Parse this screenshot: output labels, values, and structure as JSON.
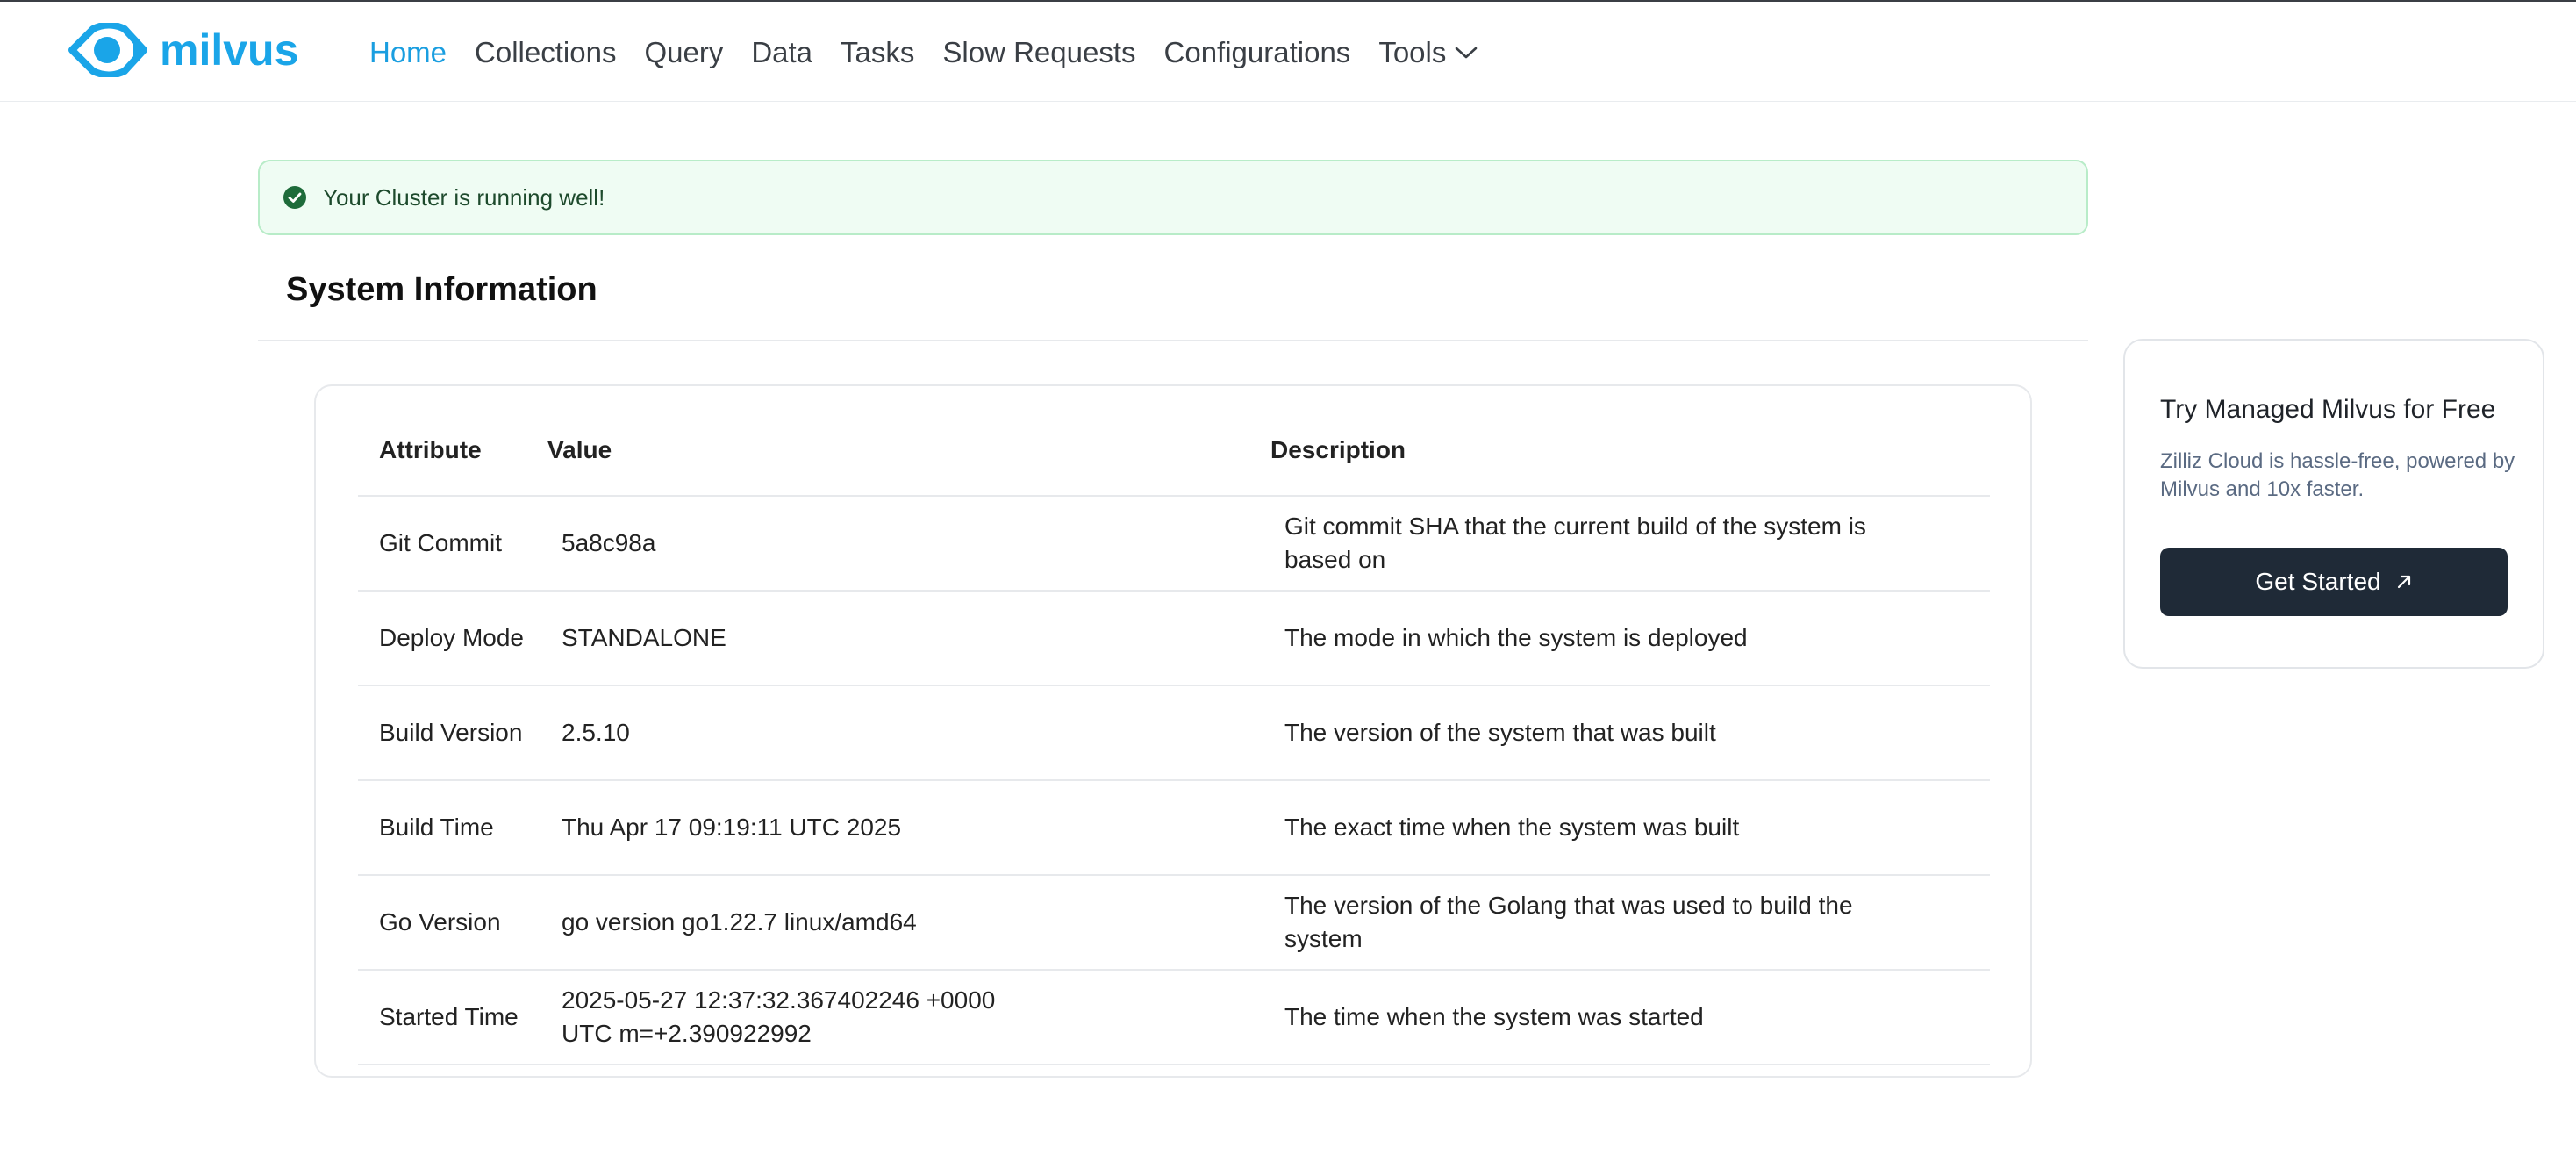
{
  "brand": {
    "name": "milvus",
    "color": "#1aa5e8"
  },
  "nav": {
    "items": [
      {
        "label": "Home",
        "active": true
      },
      {
        "label": "Collections"
      },
      {
        "label": "Query"
      },
      {
        "label": "Data"
      },
      {
        "label": "Tasks"
      },
      {
        "label": "Slow Requests"
      },
      {
        "label": "Configurations"
      }
    ],
    "tools": {
      "label": "Tools",
      "icon": "chevron-down-icon"
    }
  },
  "alert": {
    "text": "Your Cluster is running well!",
    "icon": "check-circle-icon",
    "color": "#1e6b3a"
  },
  "section": {
    "title": "System Information"
  },
  "table": {
    "headers": [
      "Attribute",
      "Value",
      "Description"
    ],
    "rows": [
      {
        "attribute": "Git Commit",
        "value": "5a8c98a",
        "description": "Git commit SHA that the current build of the system is based on"
      },
      {
        "attribute": "Deploy Mode",
        "value": "STANDALONE",
        "description": "The mode in which the system is deployed"
      },
      {
        "attribute": "Build Version",
        "value": "2.5.10",
        "description": "The version of the system that was built"
      },
      {
        "attribute": "Build Time",
        "value": "Thu Apr 17 09:19:11 UTC 2025",
        "description": "The exact time when the system was built"
      },
      {
        "attribute": "Go Version",
        "value": "go version go1.22.7 linux/amd64",
        "description": "The version of the Golang that was used to build the system"
      },
      {
        "attribute": "Started Time",
        "value": "2025-05-27 12:37:32.367402246 +0000 UTC m=+2.390922992",
        "description": "The time when the system was started"
      }
    ]
  },
  "promo": {
    "title": "Try Managed Milvus for Free",
    "description": "Zilliz Cloud is hassle-free, powered by Milvus and 10x faster.",
    "button_label": "Get Started",
    "button_icon": "arrow-up-right-icon"
  }
}
